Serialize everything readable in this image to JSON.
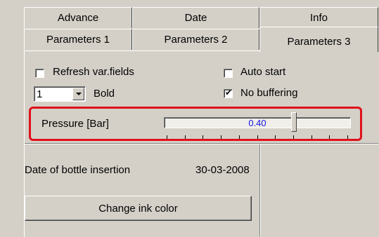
{
  "tabs_row1": [
    {
      "label": "Advance"
    },
    {
      "label": "Date"
    },
    {
      "label": "Info"
    }
  ],
  "tabs_row2": [
    {
      "label": "Parameters 1"
    },
    {
      "label": "Parameters 2"
    },
    {
      "label": "Parameters 3",
      "selected": true
    }
  ],
  "options": {
    "refresh_var_fields": {
      "label": "Refresh var.fields",
      "checked": false
    },
    "auto_start": {
      "label": "Auto start",
      "checked": false
    },
    "no_buffering": {
      "label": "No buffering",
      "checked": true,
      "mark": "✔"
    },
    "size_select": {
      "value": "1"
    },
    "bold_label": "Bold"
  },
  "pressure": {
    "label": "Pressure [Bar]",
    "value": "0.40",
    "slider_fraction": 0.7,
    "value_color": "#1515e0",
    "highlight_color": "#e0101a"
  },
  "bottle": {
    "label": "Date of bottle insertion",
    "date": "30-03-2008"
  },
  "change_ink_button": {
    "label": "Change ink color"
  },
  "icons": {
    "checkmark": "check-icon",
    "dropdown": "chevron-down-icon"
  }
}
